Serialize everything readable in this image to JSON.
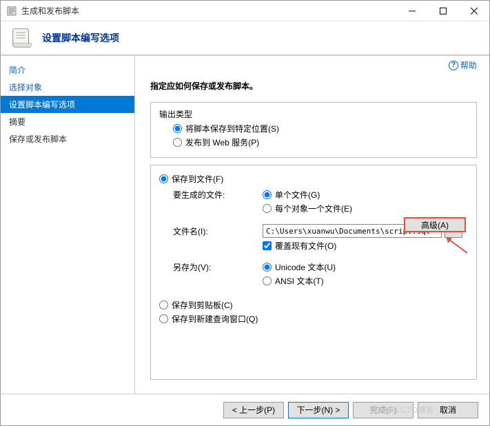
{
  "window": {
    "title": "生成和发布脚本"
  },
  "header": {
    "title": "设置脚本编写选项"
  },
  "help": {
    "label": "帮助"
  },
  "sidebar": {
    "items": [
      {
        "label": "简介"
      },
      {
        "label": "选择对象"
      },
      {
        "label": "设置脚本编写选项"
      },
      {
        "label": "摘要"
      },
      {
        "label": "保存或发布脚本"
      }
    ]
  },
  "content": {
    "instruction": "指定应如何保存或发布脚本。",
    "output_type_label": "输出类型",
    "radio_save_location": "将脚本保存到特定位置(S)",
    "radio_publish_web": "发布到 Web 服务(P)",
    "radio_save_file": "保存到文件(F)",
    "files_to_generate_label": "要生成的文件:",
    "radio_single_file": "单个文件(G)",
    "radio_per_object": "每个对象一个文件(E)",
    "filename_label": "文件名(I):",
    "filename_value": "C:\\Users\\xuanwu\\Documents\\script.sql",
    "overwrite_label": "覆盖现有文件(O)",
    "save_as_label": "另存为(V):",
    "radio_unicode": "Unicode 文本(U)",
    "radio_ansi": "ANSI 文本(T)",
    "radio_clipboard": "保存到剪贴板(C)",
    "radio_new_query": "保存到新建查询窗口(Q)",
    "advanced_btn": "高级(A)"
  },
  "footer": {
    "prev": "< 上一步(P)",
    "next": "下一步(N) >",
    "finish": "完成(F)",
    "cancel": "取消"
  },
  "watermark": "@51CTO博客"
}
